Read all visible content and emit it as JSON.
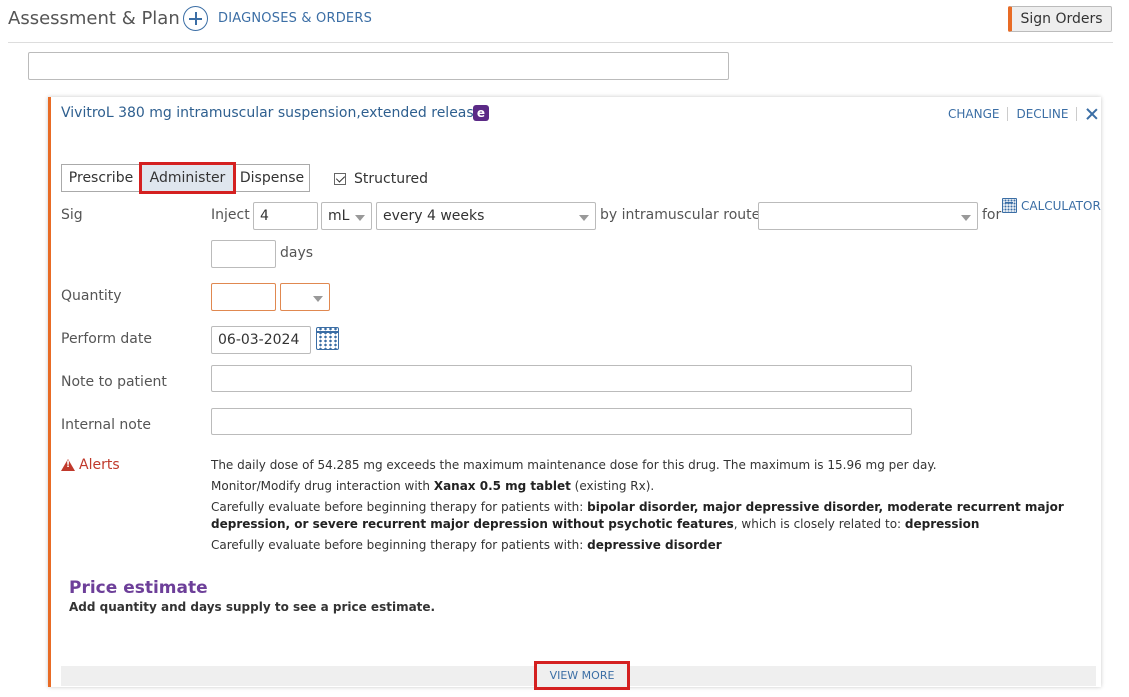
{
  "header": {
    "title": "Assessment & Plan",
    "add_label": "DIAGNOSES & ORDERS",
    "sign_orders": "Sign Orders"
  },
  "order": {
    "medication": "VivitroL 380 mg intramuscular suspension,extended release",
    "badge": "e",
    "change": "CHANGE",
    "decline": "DECLINE",
    "tabs": [
      "Prescribe",
      "Administer",
      "Dispense"
    ],
    "selected_tab": "Administer",
    "structured_label": "Structured",
    "structured_checked": true,
    "sig": {
      "label": "Sig",
      "inject_text": "Inject",
      "amount": "4",
      "unit": "mL",
      "frequency": "every 4 weeks",
      "route_text": "by intramuscular route",
      "route_value": "",
      "for_text": "for",
      "calculator": "CALCULATOR",
      "days_value": "",
      "days_text": "days"
    },
    "quantity": {
      "label": "Quantity",
      "value": "",
      "unit": ""
    },
    "perform_date": {
      "label": "Perform date",
      "value": "06-03-2024"
    },
    "note_to_patient": {
      "label": "Note to patient",
      "value": ""
    },
    "internal_note": {
      "label": "Internal note",
      "value": ""
    },
    "alerts": {
      "label": "Alerts",
      "line1": "The daily dose of 54.285 mg exceeds the maximum maintenance dose for this drug. The maximum is 15.96 mg per day.",
      "line2_pre": "Monitor/Modify drug interaction with ",
      "line2_bold": "Xanax 0.5 mg tablet",
      "line2_post": " (existing Rx).",
      "line3_pre": "Carefully evaluate before beginning therapy for patients with: ",
      "line3_bold": "bipolar disorder, major depressive disorder, moderate recurrent major depression, or severe recurrent major depression without psychotic features",
      "line3_mid": ", which is closely related to: ",
      "line3_bold2": "depression",
      "line4_pre": "Carefully evaluate before beginning therapy for patients with: ",
      "line4_bold": "depressive disorder"
    },
    "price": {
      "title": "Price estimate",
      "subtitle": "Add quantity and days supply to see a price estimate."
    },
    "view_more": "VIEW MORE"
  },
  "colors": {
    "accent_orange": "#e86b25",
    "link_blue": "#3b6ea5",
    "alert_red": "#c0392b",
    "price_purple": "#6d3f99",
    "highlight_red": "#d42020"
  }
}
